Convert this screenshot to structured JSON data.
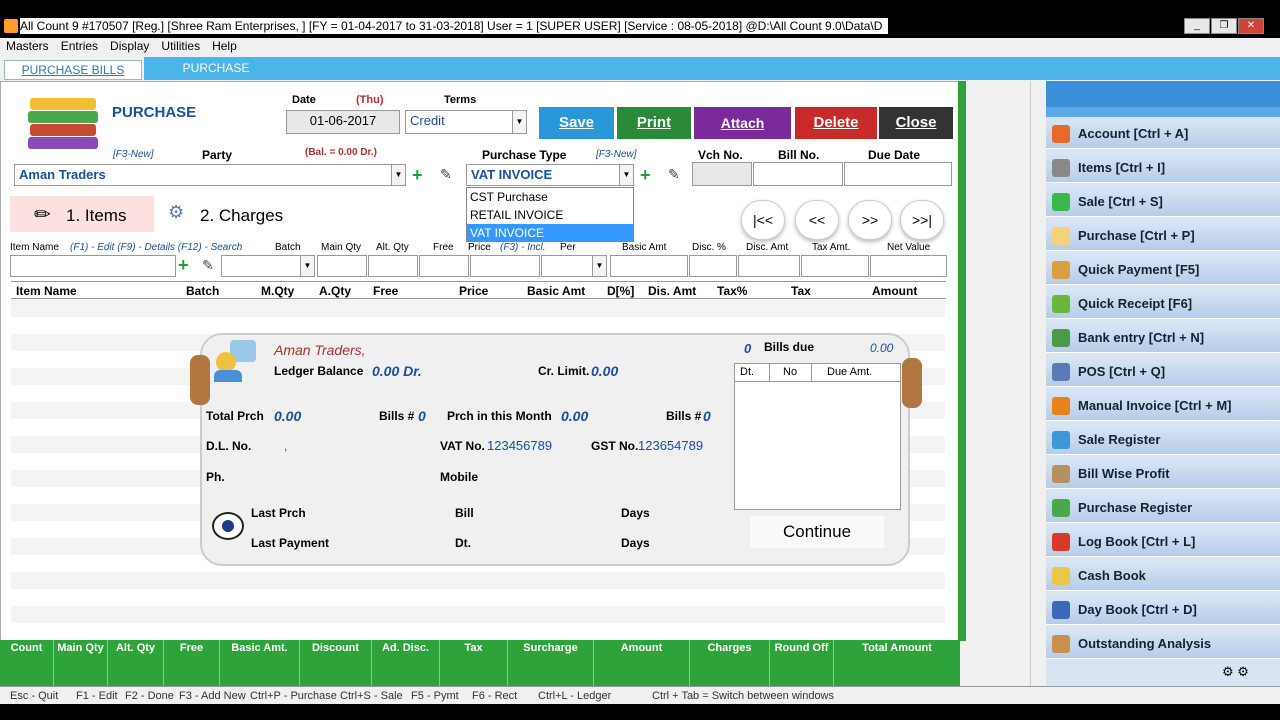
{
  "window": {
    "title": "All Count 9 #170507  [Reg.]  [Shree Ram Enterprises, ]  [FY = 01-04-2017 to 31-03-2018]  User = 1 [SUPER USER]   [Service : 08-05-2018]  @D:\\All Count 9.0\\Data\\D"
  },
  "menu": [
    "Masters",
    "Entries",
    "Display",
    "Utilities",
    "Help"
  ],
  "tabs": [
    "PURCHASE BILLS",
    "PURCHASE"
  ],
  "header": {
    "title": "PURCHASE",
    "date_label": "Date",
    "day": "(Thu)",
    "date": "01-06-2017",
    "terms_label": "Terms",
    "terms": "Credit",
    "f3new": "[F3-New]",
    "party_label": "Party",
    "balance": "(Bal. = 0.00 Dr.)",
    "party": "Aman Traders",
    "ptype_label": "Purchase Type",
    "ptype_f3": "[F3-New]",
    "ptype": "VAT INVOICE",
    "vch_label": "Vch No.",
    "bill_label": "Bill No.",
    "due_label": "Due Date"
  },
  "buttons": {
    "save": "Save",
    "print": "Print",
    "attach": "Attach",
    "delete": "Delete",
    "close": "Close"
  },
  "ptype_options": [
    "CST Purchase",
    "RETAIL INVOICE",
    "VAT INVOICE"
  ],
  "subtabs": [
    "1. Items",
    "2. Charges"
  ],
  "nav": [
    "|<<",
    "<<",
    ">>",
    ">>|"
  ],
  "entry_labels": {
    "item": "Item Name",
    "hint": "(F1) - Edit  (F9) - Details  (F12) - Search",
    "batch": "Batch",
    "mqty": "Main Qty",
    "aqty": "Alt. Qty",
    "free": "Free",
    "price": "Price",
    "f3incl": "(F3) - Incl.",
    "per": "Per",
    "basic": "Basic Amt",
    "disc": "Disc. %",
    "discamt": "Disc. Amt",
    "tax": "Tax Amt.",
    "net": "Net Value"
  },
  "grid_headers": [
    "Item Name",
    "Batch",
    "M.Qty",
    "A.Qty",
    "Free",
    "Price",
    "Basic Amt",
    "D[%]",
    "Dis. Amt",
    "Tax%",
    "Tax",
    "Amount"
  ],
  "card": {
    "party": "Aman Traders,",
    "ledger_label": "Ledger Balance",
    "ledger": "0.00 Dr.",
    "cr_label": "Cr. Limit.",
    "cr": "0.00",
    "bills_due_count": "0",
    "bills_due_label": "Bills due",
    "bills_due_amt": "0.00",
    "total_prch_label": "Total Prch",
    "total_prch": "0.00",
    "bills1_label": "Bills #",
    "bills1": "0",
    "month_label": "Prch in this Month",
    "month": "0.00",
    "bills2_label": "Bills #",
    "bills2": "0",
    "dl_label": "D.L. No.",
    "dl": ",",
    "vat_label": "VAT No.",
    "vat": "123456789",
    "gst_label": "GST No.",
    "gst": "123654789",
    "ph_label": "Ph.",
    "mobile_label": "Mobile",
    "last_prch": "Last Prch",
    "bill": "Bill",
    "days1": "Days",
    "last_payment": "Last Payment",
    "dt": "Dt.",
    "days2": "Days",
    "mini_headers": [
      "Dt.",
      "No",
      "Due Amt."
    ],
    "continue": "Continue"
  },
  "footer": [
    "Count",
    "Main Qty",
    "Alt. Qty",
    "Free",
    "Basic Amt.",
    "Discount",
    "Ad. Disc.",
    "Tax",
    "Surcharge",
    "Amount",
    "Charges",
    "Round Off",
    "Total Amount"
  ],
  "status": [
    "Esc - Quit",
    "F1 - Edit",
    "F2 - Done",
    "F3 - Add New",
    "Ctrl+P - Purchase",
    "Ctrl+S - Sale",
    "F5 - Pymt",
    "F6 - Rect",
    "Ctrl+L - Ledger",
    "Ctrl + Tab = Switch between windows"
  ],
  "sidebar": [
    {
      "label": "Account [Ctrl + A]",
      "color": "#e86a2a"
    },
    {
      "label": "Items [Ctrl + I]",
      "color": "#888888"
    },
    {
      "label": "Sale [Ctrl + S]",
      "color": "#3cb84a"
    },
    {
      "label": "Purchase [Ctrl + P]",
      "color": "#f4d27a"
    },
    {
      "label": "Quick Payment [F5]",
      "color": "#d8a040"
    },
    {
      "label": "Quick Receipt [F6]",
      "color": "#6ab83a"
    },
    {
      "label": "Bank entry [Ctrl + N]",
      "color": "#4a9a4a"
    },
    {
      "label": "POS [Ctrl + Q]",
      "color": "#5a7ab8"
    },
    {
      "label": "Manual Invoice [Ctrl + M]",
      "color": "#e8821a"
    },
    {
      "label": "Sale Register",
      "color": "#3a9ad8"
    },
    {
      "label": "Bill Wise Profit",
      "color": "#b89060"
    },
    {
      "label": "Purchase Register",
      "color": "#4aa84a"
    },
    {
      "label": "Log Book [Ctrl + L]",
      "color": "#d83a2a"
    },
    {
      "label": "Cash Book",
      "color": "#e8c84a"
    },
    {
      "label": "Day Book [Ctrl + D]",
      "color": "#3a6ab8"
    },
    {
      "label": "Outstanding Analysis",
      "color": "#c8904a"
    }
  ]
}
